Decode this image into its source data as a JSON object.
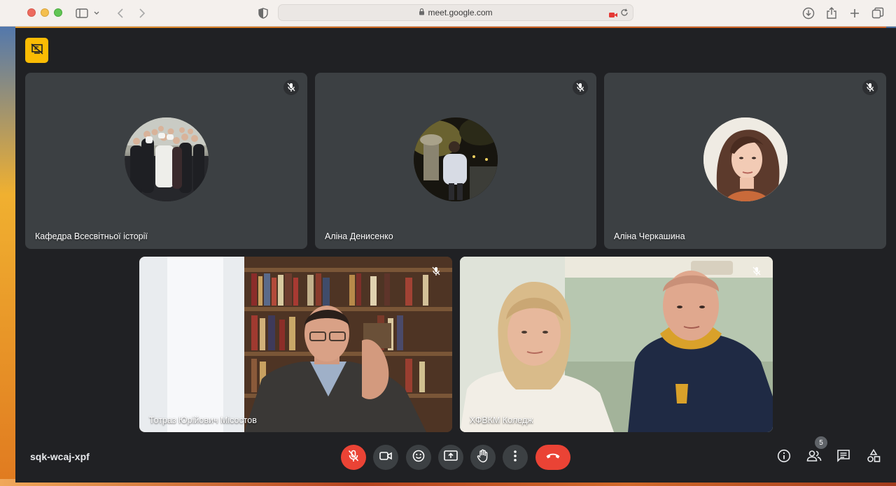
{
  "browser": {
    "url": "meet.google.com"
  },
  "meet": {
    "meeting_code": "sqk-wcaj-xpf",
    "participant_count": "5",
    "participants": [
      {
        "name": "Кафедра Всесвітньої історії",
        "muted": true,
        "camera": "off"
      },
      {
        "name": "Аліна Денисенко",
        "muted": true,
        "camera": "off"
      },
      {
        "name": "Аліна Черкашина",
        "muted": true,
        "camera": "off"
      },
      {
        "name": "Тотраз Юрійович Місостов",
        "muted": true,
        "camera": "on"
      },
      {
        "name": "ХФВКМ Коледж",
        "muted": true,
        "camera": "on"
      }
    ],
    "controls": {
      "center": [
        "mic-off",
        "camera",
        "emoji",
        "present",
        "raise-hand",
        "more-options",
        "leave-call"
      ],
      "right": [
        "meeting-details",
        "people",
        "chat",
        "activities"
      ]
    }
  },
  "colors": {
    "meet_background": "#202124",
    "tile_background": "#3c4043",
    "danger": "#ea4335",
    "presentation_badge": "#fbbc04"
  }
}
